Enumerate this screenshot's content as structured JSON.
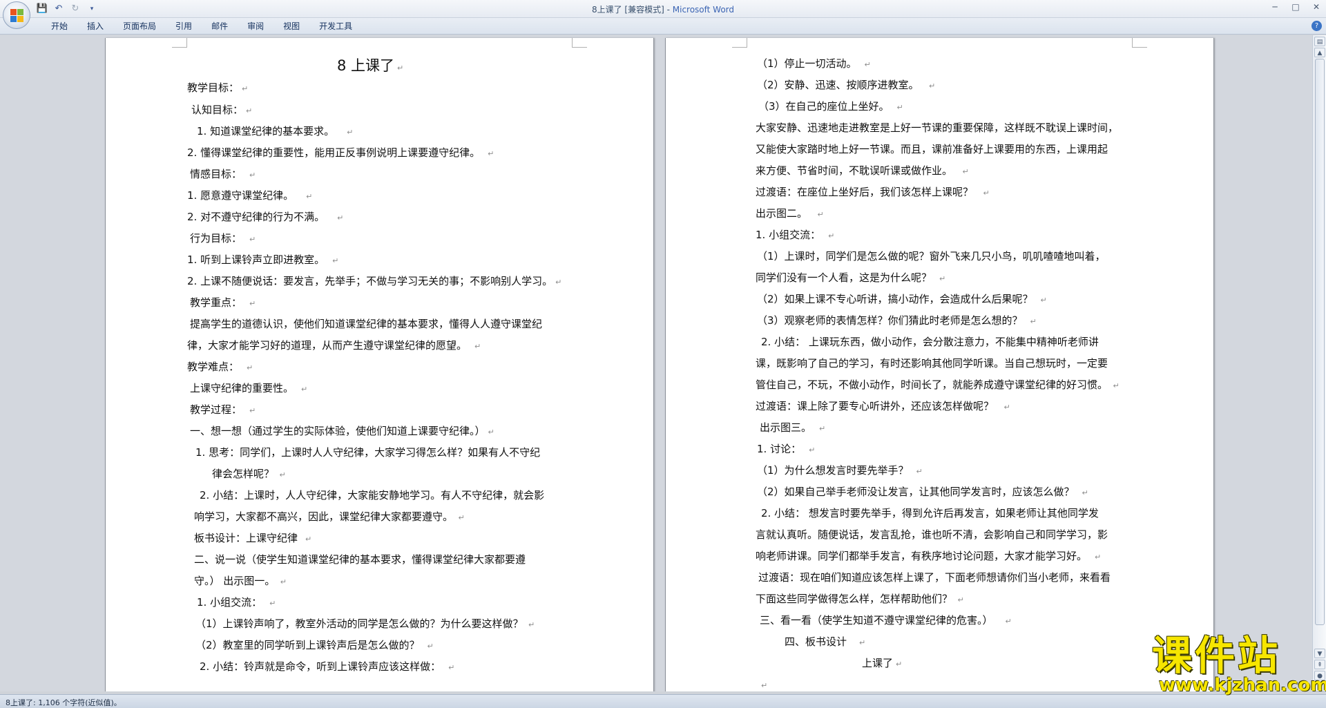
{
  "window": {
    "title_doc": "8上课了 [兼容模式] - ",
    "title_app": "Microsoft Word",
    "controls": [
      "─",
      "□",
      "✕"
    ]
  },
  "qat": {
    "save_icon": "save-icon",
    "undo_icon": "undo-icon",
    "redo_icon": "redo-icon"
  },
  "ribbon": {
    "tabs": [
      "开始",
      "插入",
      "页面布局",
      "引用",
      "邮件",
      "审阅",
      "视图",
      "开发工具"
    ],
    "help": "?"
  },
  "left_page": {
    "title": "8   上课了",
    "lines": [
      "教学目标：",
      "认知目标：",
      "1.  知道课堂纪律的基本要求。",
      "2.  懂得课堂纪律的重要性，能用正反事例说明上课要遵守纪律。",
      "情感目标：",
      "1.  愿意遵守课堂纪律。",
      "2.  对不遵守纪律的行为不满。",
      "行为目标：",
      "1.  听到上课铃声立即进教室。",
      "2. 上课不随便说话：要发言，先举手；不做与学习无关的事；不影响别人学习。",
      "教学重点：",
      "提高学生的道德认识，使他们知道课堂纪律的基本要求，懂得人人遵守课堂纪",
      "律，大家才能学习好的道理，从而产生遵守课堂纪律的愿望。",
      "教学难点：",
      "上课守纪律的重要性。",
      "教学过程：",
      "一、想一想（通过学生的实际体验，使他们知道上课要守纪律。）",
      "1.  思考：同学们，上课时人人守纪律，大家学习得怎么样？如果有人不守纪",
      "律会怎样呢？",
      "2.  小结：上课时，人人守纪律，大家能安静地学习。有人不守纪律，就会影",
      "响学习，大家都不高兴，因此，课堂纪律大家都要遵守。",
      "板书设计：上课守纪律",
      "二、说一说（使学生知道课堂纪律的基本要求，懂得课堂纪律大家都要遵",
      "守。）   出示图一。",
      "1.  小组交流：",
      "（1）上课铃声响了，教室外活动的同学是怎么做的？为什么要这样做？",
      "（2）教室里的同学听到上课铃声后是怎么做的？",
      "2.  小结：铃声就是命令，听到上课铃声应该这样做："
    ]
  },
  "right_page": {
    "lines": [
      "（1）停止一切活动。",
      "（2）安静、迅速、按顺序进教室。",
      "（3）在自己的座位上坐好。",
      "大家安静、迅速地走进教室是上好一节课的重要保障，这样既不耽误上课时间，",
      "又能使大家踏时地上好一节课。而且，课前准备好上课要用的东西，上课用起",
      "来方便、节省时间，不耽误听课或做作业。",
      "过渡语：在座位上坐好后，我们该怎样上课呢？",
      "出示图二。",
      "1.  小组交流：",
      "（1）上课时，同学们是怎么做的呢？窗外飞来几只小鸟，叽叽喳喳地叫着，",
      "同学们没有一个人看，这是为什么呢？",
      "（2）如果上课不专心听讲，搞小动作，会造成什么后果呢？",
      "（3）观察老师的表情怎样？你们猜此时老师是怎么想的？",
      "2.  小结：   上课玩东西，做小动作，会分散注意力，不能集中精神听老师讲",
      "课，既影响了自己的学习，有时还影响其他同学听课。当自己想玩时，一定要",
      "管住自己，不玩，不做小动作，时间长了，就能养成遵守课堂纪律的好习惯。",
      "过渡语：课上除了要专心听讲外，还应该怎样做呢？",
      "出示图三。",
      "1.  讨论：",
      "（1）为什么想发言时要先举手？",
      "（2）如果自己举手老师没让发言，让其他同学发言时，应该怎么做？",
      "2.  小结：   想发言时要先举手，得到允许后再发言，如果老师让其他同学发",
      "言就认真听。随便说话，发言乱抢，谁也听不清，会影响自己和同学学习，影",
      "响老师讲课。同学们都举手发言，有秩序地讨论问题，大家才能学习好。",
      "过渡语：现在咱们知道应该怎样上课了，下面老师想请你们当小老师，来看看",
      "下面这些同学做得怎么样，怎样帮助他们？",
      "三、看一看（使学生知道不遵守课堂纪律的危害。）",
      "四、板书设计",
      "上课了",
      ""
    ]
  },
  "status": {
    "text": "8上课了: 1,106 个字符(近似值)。"
  },
  "watermark": {
    "main": "课件站",
    "sub": "www.kjzhan.com"
  },
  "colors": {
    "title_app": "#3b64b3",
    "watermark": "#f7e600"
  }
}
